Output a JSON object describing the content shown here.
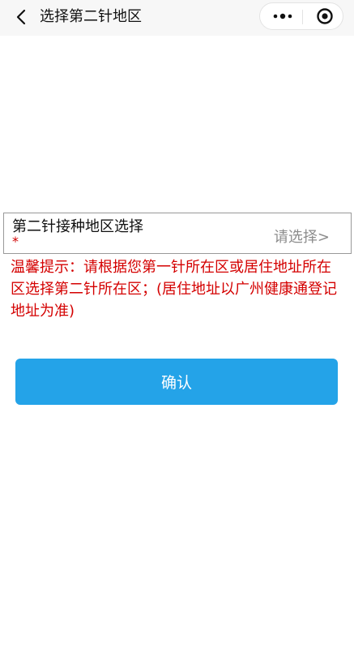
{
  "navbar": {
    "title": "选择第二针地区",
    "back_icon": "chevron-left-icon",
    "more_icon": "more-dots-icon",
    "close_icon": "target-close-icon"
  },
  "form": {
    "region_label": "第二针接种地区选择",
    "required_mark": "*",
    "region_value": "请选择>"
  },
  "notice": {
    "text": "温馨提示：请根据您第一针所在区或居住地址所在区选择第二针所在区；(居住地址以广州健康通登记地址为准)"
  },
  "actions": {
    "confirm_label": "确认"
  },
  "colors": {
    "accent": "#24a3e8",
    "warning": "#d40000",
    "navbar_bg": "#f7f7f7"
  }
}
